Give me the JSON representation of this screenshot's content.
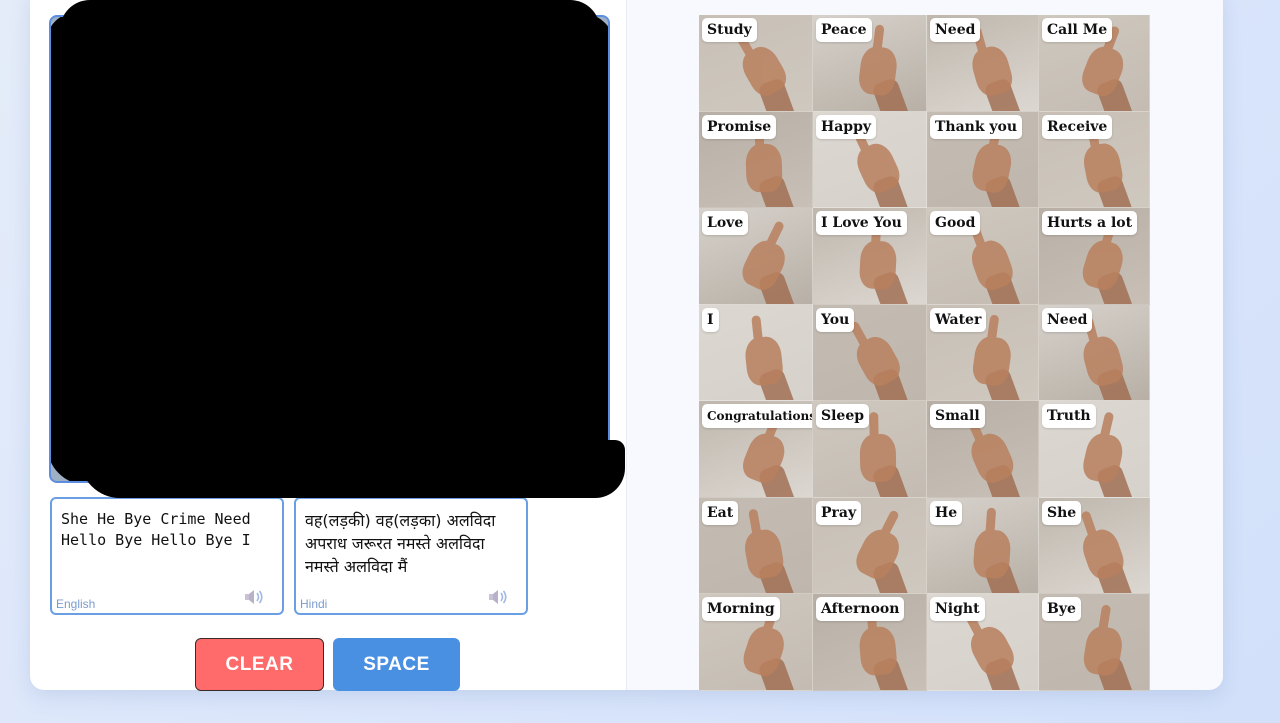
{
  "output": {
    "english_text": "She He Bye Crime Need Hello Bye Hello Bye I",
    "english_label": "English",
    "hindi_text": "वह(लड़की) वह(लड़का) अलविदा अपराध जरूरत नमस्ते अलविदा नमस्ते अलविदा मैं",
    "hindi_label": "Hindi"
  },
  "buttons": {
    "clear_label": "CLEAR",
    "space_label": "SPACE"
  },
  "colors": {
    "clear_button": "#ff6b6b",
    "space_button": "#4a90e2",
    "box_border": "#6b9fe3"
  },
  "signs": [
    "Study",
    "Peace",
    "Need",
    "Call Me",
    "Promise",
    "Happy",
    "Thank you",
    "Receive",
    "Love",
    "I Love You",
    "Good",
    "Hurts a lot",
    "I",
    "You",
    "Water",
    "Need",
    "Congratulations",
    "Sleep",
    "Small",
    "Truth",
    "Eat",
    "Pray",
    "He",
    "She",
    "Morning",
    "Afternoon",
    "Night",
    "Bye"
  ]
}
